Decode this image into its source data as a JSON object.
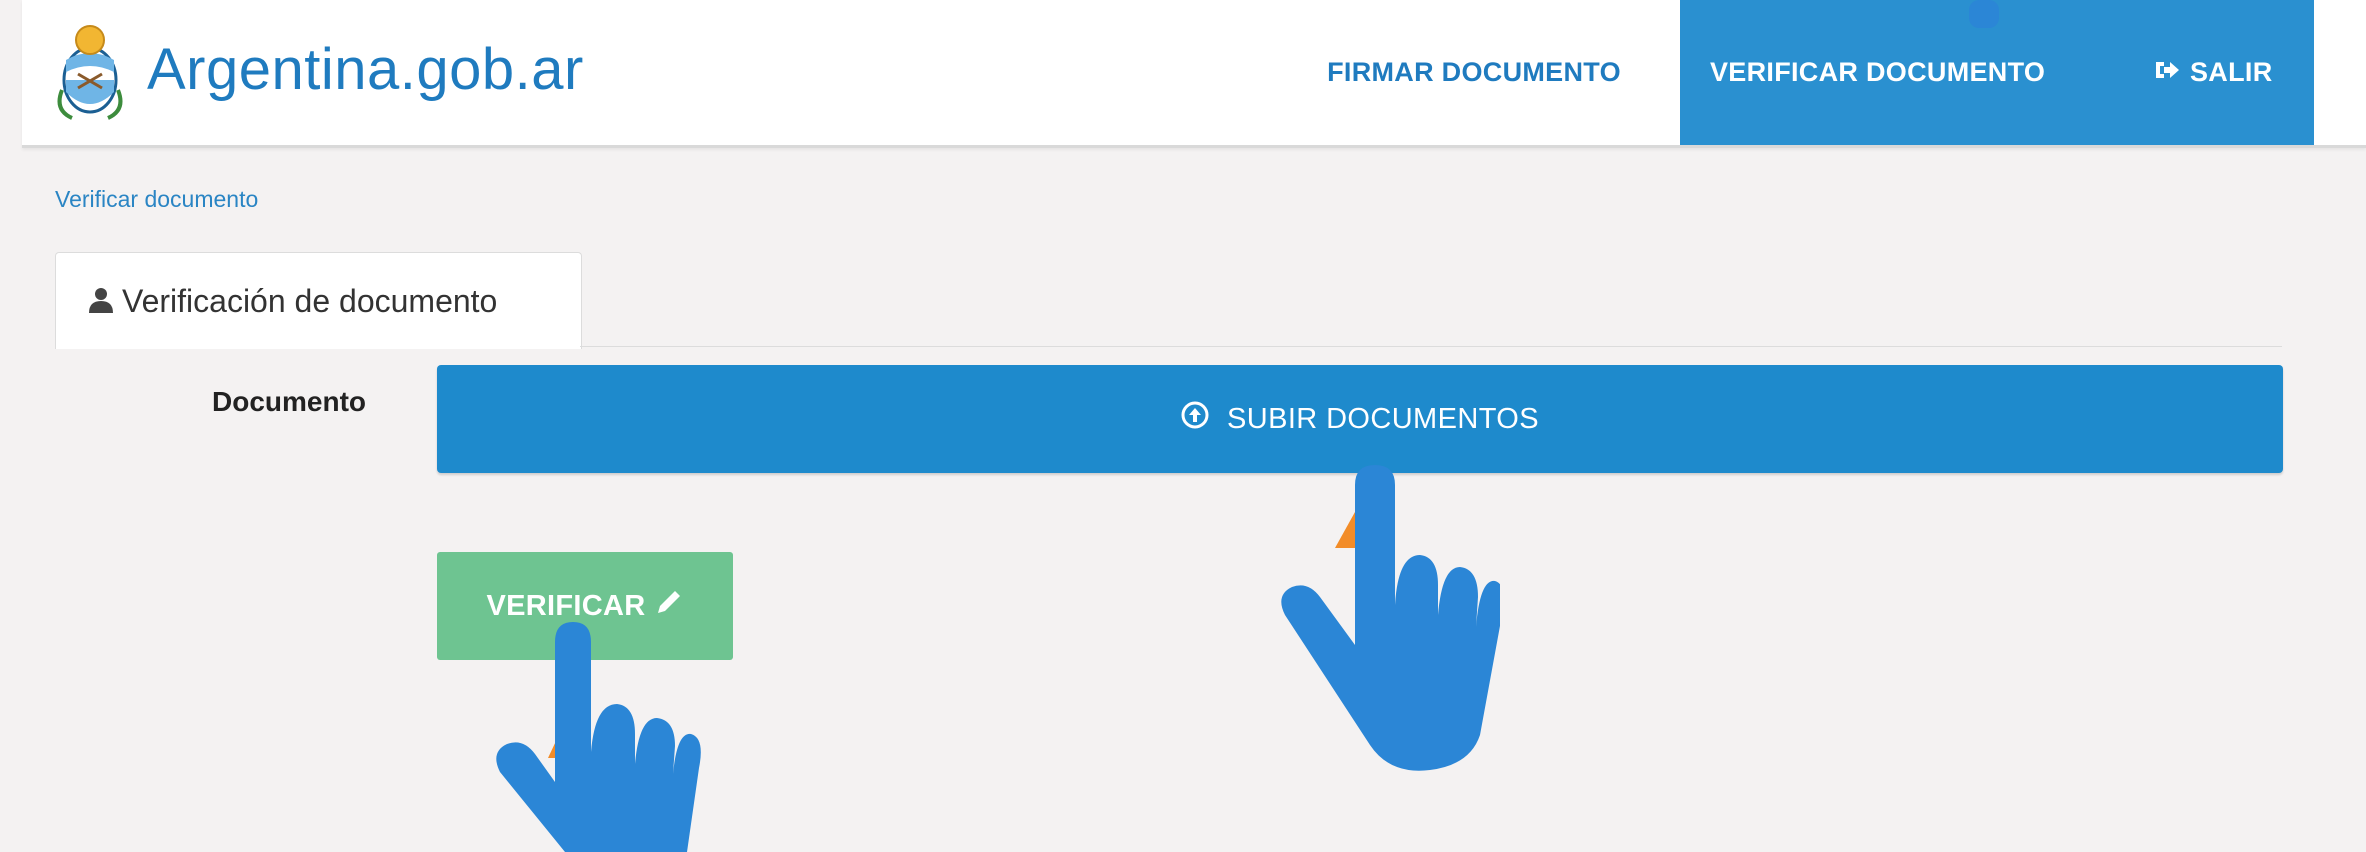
{
  "header": {
    "brand": "Argentina.gob.ar",
    "nav": {
      "firmar": "FIRMAR DOCUMENTO",
      "verificar": "VERIFICAR DOCUMENTO",
      "salir": "SALIR"
    }
  },
  "breadcrumb": "Verificar documento",
  "tab": {
    "label": "Verificación de documento",
    "icon": "user-icon"
  },
  "form": {
    "document_label": "Documento",
    "upload_button": "SUBIR DOCUMENTOS",
    "verify_button": "VERIFICAR"
  },
  "colors": {
    "brand": "#1f7bbf",
    "active_nav": "#2a90d0",
    "upload": "#1e8acc",
    "verify": "#6ec491",
    "hand": "#2b86d6",
    "accent_marker": "#f28c28"
  }
}
